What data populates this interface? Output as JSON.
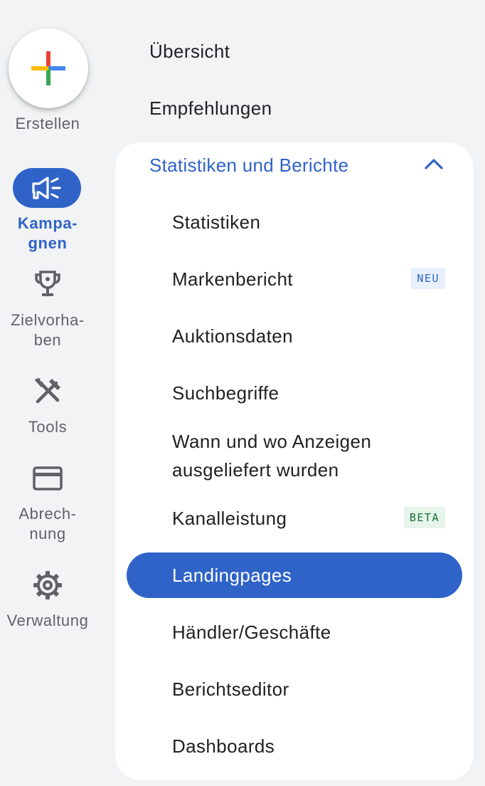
{
  "rail": {
    "create_label": "Erstellen",
    "items": [
      {
        "label_line1": "Kampa-",
        "label_line2": "gnen",
        "icon": "campaign-megaphone-icon",
        "active": true
      },
      {
        "label_line1": "Zielvorha-",
        "label_line2": "ben",
        "icon": "trophy-icon",
        "active": false
      },
      {
        "label_line1": "Tools",
        "icon": "tools-icon",
        "active": false
      },
      {
        "label_line1": "Abrech-",
        "label_line2": "nung",
        "icon": "credit-card-icon",
        "active": false
      },
      {
        "label_line1": "Verwaltung",
        "icon": "gear-icon",
        "active": false
      }
    ]
  },
  "nav": {
    "overview": "Übersicht",
    "recommendations": "Empfehlungen"
  },
  "section": {
    "title": "Statistiken und Berichte",
    "expanded": true,
    "items": [
      {
        "label": "Statistiken"
      },
      {
        "label": "Markenbericht",
        "badge": "NEU"
      },
      {
        "label": "Auktionsdaten"
      },
      {
        "label": "Suchbegriffe"
      },
      {
        "label_line1": "Wann und wo Anzeigen",
        "label_line2": "ausgeliefert wurden"
      },
      {
        "label": "Kanalleistung",
        "badge": "BETA"
      },
      {
        "label": "Landingpages",
        "selected": true
      },
      {
        "label": "Händler/Geschäfte"
      },
      {
        "label": "Berichtseditor"
      },
      {
        "label": "Dashboards"
      }
    ]
  },
  "colors": {
    "accent": "#2f63c8",
    "background": "#f1f3f4",
    "card": "#ffffff",
    "badge_new_bg": "#e8f0fe",
    "badge_beta_bg": "#e6f4ea",
    "badge_beta_text": "#137333"
  }
}
